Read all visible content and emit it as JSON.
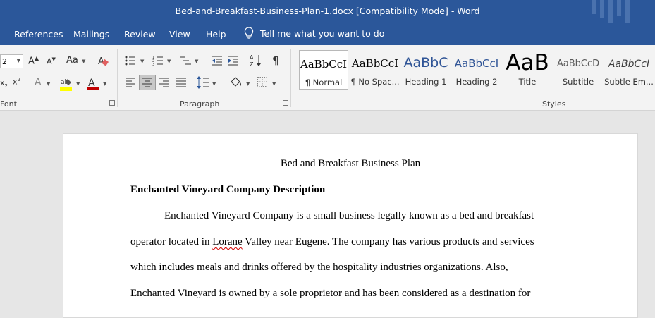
{
  "window": {
    "title": "Bed-and-Breakfast-Business-Plan-1.docx [Compatibility Mode]  -  Word"
  },
  "tabs": [
    "References",
    "Mailings",
    "Review",
    "View",
    "Help"
  ],
  "tell_me": "Tell me what you want to do",
  "font_group": {
    "size_value": "2",
    "label": "Font"
  },
  "paragraph_group": {
    "label": "Paragraph"
  },
  "styles_group": {
    "label": "Styles",
    "items": [
      {
        "preview": "AaBbCcI",
        "name": "¶ Normal",
        "color": "#000000"
      },
      {
        "preview": "AaBbCcI",
        "name": "¶ No Spac...",
        "color": "#000000"
      },
      {
        "preview": "AaBbC",
        "name": "Heading 1",
        "color": "#2f5496"
      },
      {
        "preview": "AaBbCcI",
        "name": "Heading 2",
        "color": "#2f5496"
      },
      {
        "preview": "AaB",
        "name": "Title",
        "color": "#000000"
      },
      {
        "preview": "AaBbCcD",
        "name": "Subtitle",
        "color": "#5a5a5a"
      },
      {
        "preview": "AaBbCcI",
        "name": "Subtle Em...",
        "color": "#404040"
      }
    ]
  },
  "document": {
    "title": "Bed and Breakfast Business Plan",
    "heading": "Enchanted Vineyard Company Description",
    "lines": [
      "Enchanted Vineyard Company is a small business legally known as a bed and breakfast",
      {
        "before": "operator located in ",
        "misspelled": "Lorane",
        "after": " Valley near Eugene. The company has various products and services"
      },
      "which includes meals and drinks offered by the hospitality industries organizations. Also,",
      "Enchanted Vineyard is owned by a sole proprietor and has been considered as a destination for"
    ]
  },
  "colors": {
    "accent": "#2b579a",
    "highlight": "#ffff00",
    "font_color": "#c00000"
  }
}
